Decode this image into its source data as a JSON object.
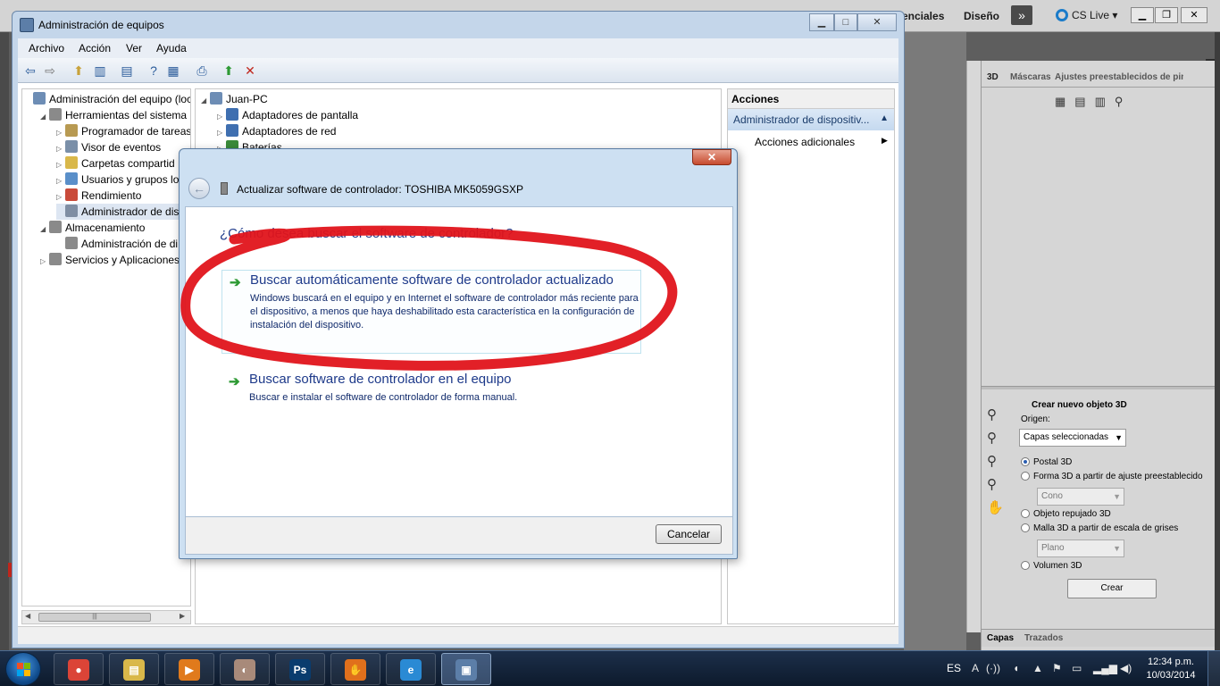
{
  "photoshop": {
    "workspace_partial": "enciales",
    "workspace_design": "Diseño",
    "more_symbol": "»",
    "cs_live": "CS Live",
    "cs_live_arrow": "▾",
    "panel_tabs": [
      "3D",
      "Máscaras",
      "Ajustes preestablecidos de pinc"
    ],
    "create_title": "Crear nuevo objeto 3D",
    "origin_label": "Origen:",
    "origin_value": "Capas seleccionadas",
    "options": [
      {
        "label": "Postal 3D",
        "selected": true
      },
      {
        "label": "Forma 3D a partir de ajuste preestablecido",
        "selected": false
      },
      {
        "label": "Objeto repujado 3D",
        "selected": false
      },
      {
        "label": "Malla 3D a partir de escala de grises",
        "selected": false
      },
      {
        "label": "Volumen 3D",
        "selected": false
      }
    ],
    "shape_value": "Cono",
    "mesh_value": "Plano",
    "create_button": "Crear",
    "bottom_tabs": [
      "Capas",
      "Trazados"
    ]
  },
  "mmc": {
    "title": "Administración de equipos",
    "menu": [
      "Archivo",
      "Acción",
      "Ver",
      "Ayuda"
    ],
    "tree": [
      {
        "label": "Administración del equipo (loc",
        "level": 0,
        "expander": "",
        "color": "#6d8db5"
      },
      {
        "label": "Herramientas del sistema",
        "level": 1,
        "expander": "◢",
        "color": "#8a8a8a"
      },
      {
        "label": "Programador de tareas",
        "level": 2,
        "expander": "▷",
        "color": "#b89a52"
      },
      {
        "label": "Visor de eventos",
        "level": 2,
        "expander": "▷",
        "color": "#7a8fa8"
      },
      {
        "label": "Carpetas compartid",
        "level": 2,
        "expander": "▷",
        "color": "#d9b84a"
      },
      {
        "label": "Usuarios y grupos loc",
        "level": 2,
        "expander": "▷",
        "color": "#5a8fc9"
      },
      {
        "label": "Rendimiento",
        "level": 2,
        "expander": "▷",
        "color": "#c94b3a"
      },
      {
        "label": "Administrador de dis",
        "level": 2,
        "expander": "",
        "color": "#7f8ea3",
        "selected": true
      },
      {
        "label": "Almacenamiento",
        "level": 1,
        "expander": "◢",
        "color": "#8a8a8a"
      },
      {
        "label": "Administración de di",
        "level": 2,
        "expander": "",
        "color": "#8a8a8a"
      },
      {
        "label": "Servicios y Aplicaciones",
        "level": 1,
        "expander": "▷",
        "color": "#8a8a8a"
      }
    ],
    "devices": [
      {
        "label": "Juan-PC",
        "level": 0,
        "expander": "◢",
        "color": "#6d8db5"
      },
      {
        "label": "Adaptadores de pantalla",
        "level": 1,
        "expander": "▷",
        "color": "#3f6fb0"
      },
      {
        "label": "Adaptadores de red",
        "level": 1,
        "expander": "▷",
        "color": "#3f6fb0"
      },
      {
        "label": "Baterías",
        "level": 1,
        "expander": "▷",
        "color": "#3a8a3a"
      }
    ],
    "actions_header": "Acciones",
    "actions_selected": "Administrador de dispositiv...",
    "actions_more": "Acciones adicionales"
  },
  "dialog": {
    "close_symbol": "✕",
    "title": "Actualizar software de controlador: TOSHIBA MK5059GSXP",
    "question": "¿Cómo desea buscar el software de controlador?",
    "option1_title": "Buscar automáticamente software de controlador actualizado",
    "option1_desc": "Windows buscará en el equipo y en Internet el software de controlador más reciente para el dispositivo, a menos que haya deshabilitado esta característica en la configuración de instalación del dispositivo.",
    "option2_title": "Buscar software de controlador en el equipo",
    "option2_desc": "Buscar e instalar el software de controlador de forma manual.",
    "cancel": "Cancelar"
  },
  "taskbar": {
    "apps": [
      {
        "name": "chrome",
        "glyph": "●",
        "color": "#db4437"
      },
      {
        "name": "explorer",
        "glyph": "▤",
        "color": "#d9b84a"
      },
      {
        "name": "media",
        "glyph": "▶",
        "color": "#e07a1c"
      },
      {
        "name": "photo",
        "glyph": "◐",
        "color": "#a88a7a"
      },
      {
        "name": "photoshop",
        "glyph": "Ps",
        "color": "#0a3c6e"
      },
      {
        "name": "hand",
        "glyph": "✋",
        "color": "#e0701c"
      },
      {
        "name": "internet-explorer",
        "glyph": "e",
        "color": "#2a8ad4"
      },
      {
        "name": "computer-management",
        "glyph": "▣",
        "color": "#5c7ea8"
      }
    ],
    "lang": "ES",
    "time": "12:34 p.m.",
    "date": "10/03/2014"
  }
}
